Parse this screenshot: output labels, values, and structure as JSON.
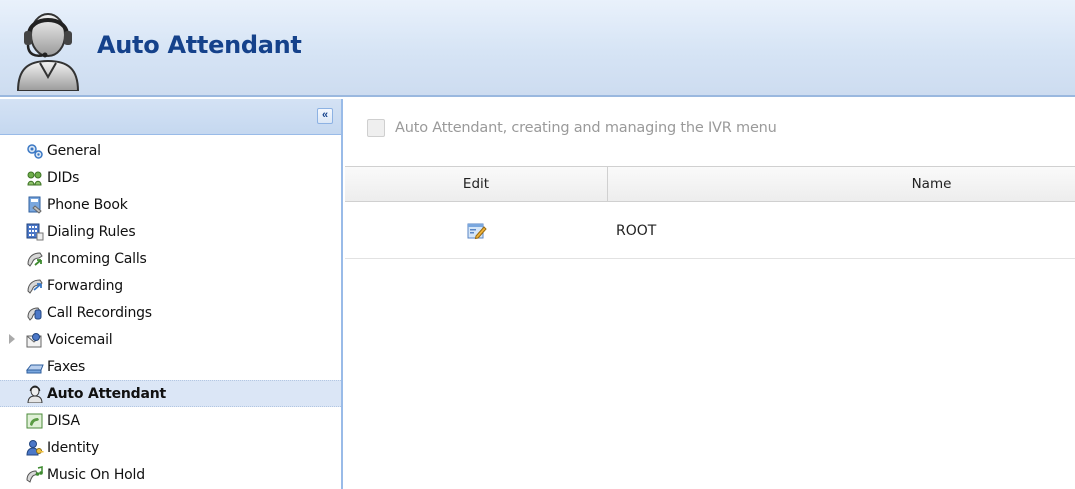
{
  "header": {
    "title": "Auto Attendant",
    "icon": "operator-headset-icon"
  },
  "sidebar": {
    "collapse_label": "«",
    "items": [
      {
        "label": "General",
        "icon": "gears-icon"
      },
      {
        "label": "DIDs",
        "icon": "dids-icon"
      },
      {
        "label": "Phone Book",
        "icon": "phone-book-icon"
      },
      {
        "label": "Dialing Rules",
        "icon": "dialing-rules-icon"
      },
      {
        "label": "Incoming Calls",
        "icon": "incoming-calls-icon"
      },
      {
        "label": "Forwarding",
        "icon": "forwarding-icon"
      },
      {
        "label": "Call Recordings",
        "icon": "call-recordings-icon"
      },
      {
        "label": "Voicemail",
        "icon": "voicemail-icon",
        "expandable": true
      },
      {
        "label": "Faxes",
        "icon": "fax-icon"
      },
      {
        "label": "Auto Attendant",
        "icon": "auto-attendant-icon",
        "active": true
      },
      {
        "label": "DISA",
        "icon": "disa-icon"
      },
      {
        "label": "Identity",
        "icon": "identity-icon"
      },
      {
        "label": "Music On Hold",
        "icon": "music-on-hold-icon"
      }
    ]
  },
  "main": {
    "description": "Auto Attendant, creating and managing the IVR menu",
    "columns": {
      "edit": "Edit",
      "name": "Name"
    },
    "rows": [
      {
        "name": "ROOT",
        "icon": "edit-icon"
      }
    ]
  },
  "colors": {
    "accent": "#15428b",
    "active_row": "#dbe6f6",
    "border": "#99bbe8"
  }
}
